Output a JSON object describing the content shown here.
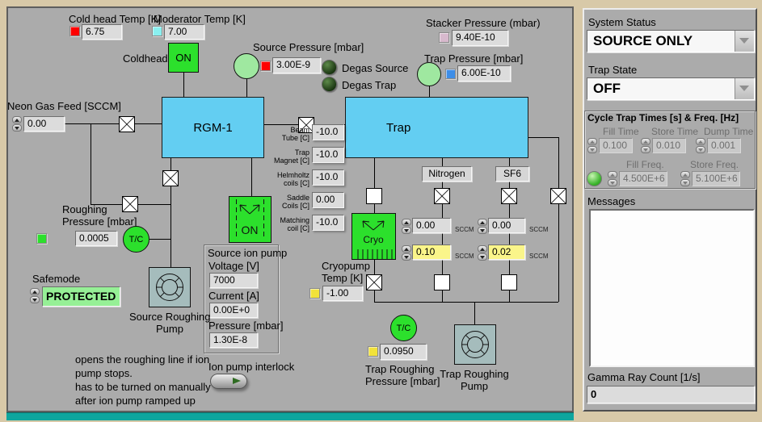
{
  "header": {
    "cold_head_label": "Cold head Temp [K]",
    "moderator_label": "Moderator Temp [K]",
    "cold_head_value": "6.75",
    "moderator_value": "7.00",
    "coldhead_label": "Coldhead",
    "coldhead_state": "ON"
  },
  "pressures": {
    "source": {
      "label": "Source Pressure [mbar]",
      "value": "3.00E-9"
    },
    "stacker": {
      "label": "Stacker Pressure (mbar)",
      "value": "9.40E-10"
    },
    "trap": {
      "label": "Trap Pressure [mbar]",
      "value": "6.00E-10"
    },
    "roughing": {
      "label": "Roughing\nPressure [mbar]",
      "value": "0.0005"
    },
    "trap_roughing": {
      "label": "Trap Roughing\nPressure [mbar]",
      "value": "0.0950"
    }
  },
  "degas": {
    "source_label": "Degas Source",
    "trap_label": "Degas Trap"
  },
  "neon": {
    "label": "Neon Gas Feed [SCCM]",
    "value": "0.00"
  },
  "blocks": {
    "rgm": "RGM-1",
    "trap": "Trap",
    "ion_pump_state": "ON",
    "cryo": "Cryo",
    "tc": "T/C"
  },
  "coils": [
    {
      "label": "Beam\nTube [C]",
      "value": "-10.0"
    },
    {
      "label": "Trap\nMagnet [C]",
      "value": "-10.0"
    },
    {
      "label": "Helmholtz\ncoils [C]",
      "value": "-10.0"
    },
    {
      "label": "Saddle\nCoils [C]",
      "value": "0.00"
    },
    {
      "label": "Matching\ncoil [C]",
      "value": "-10.0"
    }
  ],
  "ion_pump": {
    "title": "Source ion pump",
    "voltage_label": "Voltage [V]",
    "voltage_value": "7000",
    "current_label": "Current [A]",
    "current_value": "0.00E+0",
    "pressure_label": "Pressure [mbar]",
    "pressure_value": "1.30E-8",
    "interlock_label": "Ion pump interlock"
  },
  "safemode": {
    "label": "Safemode",
    "value": "PROTECTED"
  },
  "pumps": {
    "source_roughing_label": "Source Roughing\nPump",
    "trap_roughing_label": "Trap Roughing\nPump"
  },
  "cryopump": {
    "label": "Cryopump\nTemp [K]",
    "value": "-1.00"
  },
  "gas_feeds": {
    "nitrogen_label": "Nitrogen",
    "sf6_label": "SF6",
    "unit": "SCCM",
    "nitrogen_upper": "0.00",
    "nitrogen_lower": "0.10",
    "sf6_upper": "0.00",
    "sf6_lower": "0.02"
  },
  "notes": "opens the roughing line if ion\npump stops.\nhas to be turned on manually\nafter ion pump ramped up",
  "sidebar": {
    "system_status_label": "System Status",
    "system_status_value": "SOURCE ONLY",
    "trap_state_label": "Trap State",
    "trap_state_value": "OFF",
    "cycle": {
      "title": "Cycle Trap Times [s] & Freq. [Hz]",
      "fill_time_label": "Fill Time",
      "fill_time_value": "0.100",
      "store_time_label": "Store Time",
      "store_time_value": "0.010",
      "dump_time_label": "Dump Time",
      "dump_time_value": "0.001",
      "fill_freq_label": "Fill Freq.",
      "fill_freq_value": "4.500E+6",
      "store_freq_label": "Store Freq.",
      "store_freq_value": "5.100E+6"
    },
    "messages_label": "Messages",
    "gamma_label": "Gamma Ray Count [1/s]",
    "gamma_value": "0"
  },
  "colors": {
    "bright_green": "#2ce02c",
    "pale_green": "#9fe8a0",
    "cyan_block": "#63cef2",
    "yellow_field": "#faf58a",
    "teal_strip": "#0ea59e",
    "panel_gray": "#ababab"
  }
}
